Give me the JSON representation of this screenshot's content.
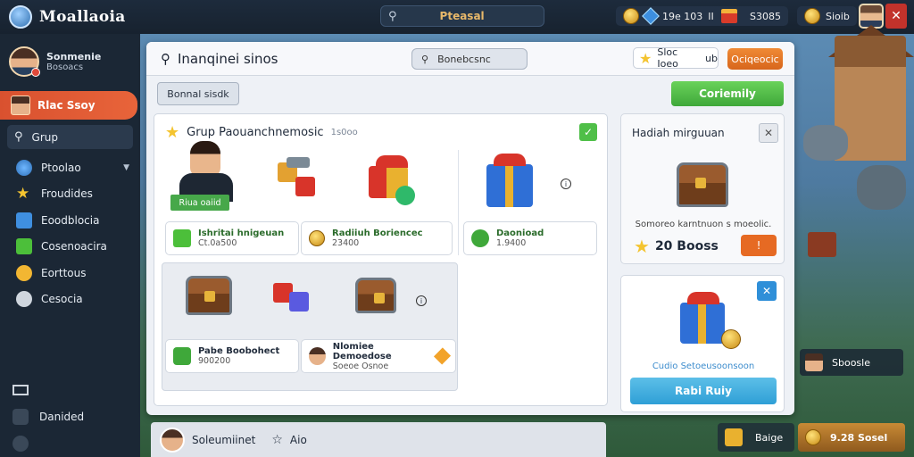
{
  "app": {
    "title": "Moallaoia"
  },
  "topbar": {
    "search_label": "Pteasal",
    "currency1": "19e 103",
    "currency1_extra": "IIXD",
    "currency2": "S3085",
    "currency3": "Sioib"
  },
  "sidebar": {
    "profile_name": "Sonmenie",
    "profile_sub": "Bosoacs",
    "active_item": "Rlac Ssoy",
    "grup_item": "Grup",
    "items": [
      {
        "label": "Ptoolao",
        "icon": "globe-icon"
      },
      {
        "label": "Froudides",
        "icon": "star-icon"
      },
      {
        "label": "Eoodblocia",
        "icon": "cube-icon"
      },
      {
        "label": "Cosenoacira",
        "icon": "green-cube-icon"
      },
      {
        "label": "Eorttous",
        "icon": "face-icon"
      },
      {
        "label": "Cesocia",
        "icon": "circle-icon"
      }
    ],
    "bottom_item": "Danided"
  },
  "main": {
    "title": "Inanqinei sinos",
    "search_value": "Bonebcsnc",
    "star_pill": "Sloc Ioeo",
    "star_pill_suffix": "ub",
    "orange_button": "Ociqeocic",
    "grey_button": "Bonnal sisdk",
    "green_button": "Coriemily"
  },
  "group": {
    "title": "Grup Paouanchnemosic",
    "subtitle": "1s0oo",
    "hero_badge": "Riua oaiid",
    "pill1_title": "Ishritai hnigeuan",
    "pill1_sub": "Ct.0a500",
    "pill2_title": "Radiiuh Boriencec",
    "pill2_sub": "23400",
    "pill3_title": "Daonioad",
    "pill3_sub": "1.9400",
    "pill4_title": "Pabe Boobohect",
    "pill4_sub": "900200",
    "pill5_title": "Nlomiee Demoedose",
    "pill5_sub": "Soeoe Osnoe"
  },
  "card1": {
    "title": "Hadiah mirguuan",
    "desc": "Somoreo karntnuon s moeolic.",
    "amount": "20 Booss"
  },
  "card2": {
    "caption": "Cudio Setoeusoonsoon",
    "button": "Rabi Ruiy"
  },
  "bottom": {
    "chat_name": "Soleumiinet",
    "chat_extra": "Aio",
    "chip1": "Baige",
    "chip2": "9.28 Sosel",
    "scene_chip": "Sboosle"
  }
}
